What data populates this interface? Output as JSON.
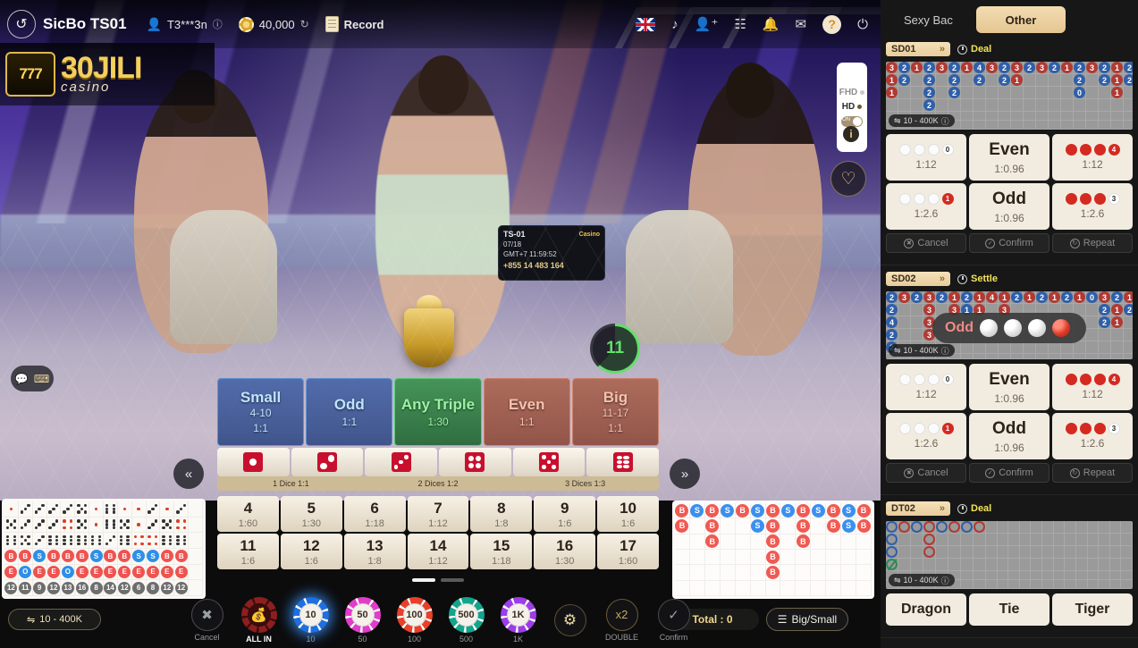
{
  "topbar": {
    "back_icon": "back-arrow-icon",
    "game_name": "SicBo TS01",
    "user_icon": "user-icon",
    "username": "T3***3n",
    "info_icon": "info-icon",
    "balance_icon": "chip-icon",
    "balance": "40,000",
    "refresh_icon": "refresh-icon",
    "record_icon": "record-icon",
    "record_label": "Record",
    "right_icons": [
      "flag-uk-icon",
      "music-icon",
      "add-friend-icon",
      "apps-icon",
      "bell-icon",
      "mail-icon",
      "help-icon",
      "power-icon"
    ]
  },
  "video": {
    "logo_badge": "777",
    "logo_word": "30JILI",
    "logo_sub": "casino",
    "quality": {
      "fhd": "FHD",
      "hd": "HD",
      "toggle": "ON",
      "selected": "HD"
    },
    "info_icon": "info-icon",
    "favorite_icon": "favorite-heart-icon",
    "chat_icon": "chat-icon",
    "keyboard_icon": "keyboard-icon",
    "timer_value": "11",
    "timer_color": "#62e06a",
    "board": {
      "table": "TS-01",
      "date": "07/18",
      "gmt": "GMT+7  11:59:52",
      "phone": "+855 14 483 164",
      "brand": "Casino"
    }
  },
  "main_bets": {
    "items": [
      {
        "title": "Small",
        "range": "4-10",
        "odds": "1:1",
        "style": "blue",
        "selected": false
      },
      {
        "title": "Odd",
        "range": "",
        "odds": "1:1",
        "style": "blue",
        "selected": false
      },
      {
        "title": "Any Triple",
        "range": "",
        "odds": "1:30",
        "style": "green",
        "selected": false
      },
      {
        "title": "Even",
        "range": "",
        "odds": "1:1",
        "style": "red",
        "selected": false
      },
      {
        "title": "Big",
        "range": "11-17",
        "odds": "1:1",
        "style": "red",
        "selected": false
      }
    ],
    "dice_buttons": [
      1,
      2,
      3,
      4,
      5,
      6
    ],
    "dice_labels": [
      "1 Dice 1:1",
      "2 Dices 1:2",
      "3 Dices 1:3"
    ],
    "numbers": [
      {
        "n": "4",
        "o": "1:60"
      },
      {
        "n": "5",
        "o": "1:30"
      },
      {
        "n": "6",
        "o": "1:18"
      },
      {
        "n": "7",
        "o": "1:12"
      },
      {
        "n": "8",
        "o": "1:8"
      },
      {
        "n": "9",
        "o": "1:6"
      },
      {
        "n": "10",
        "o": "1:6"
      },
      {
        "n": "11",
        "o": "1:6"
      },
      {
        "n": "12",
        "o": "1:6"
      },
      {
        "n": "13",
        "o": "1:8"
      },
      {
        "n": "14",
        "o": "1:12"
      },
      {
        "n": "15",
        "o": "1:18"
      },
      {
        "n": "16",
        "o": "1:30"
      },
      {
        "n": "17",
        "o": "1:60"
      }
    ],
    "pager": {
      "pages": 2,
      "active": 0
    },
    "arrow_left_icon": "chevron-left-double-icon",
    "arrow_right_icon": "chevron-right-double-icon"
  },
  "bottom": {
    "limit_badge": "10 - 400K",
    "limit_icon": "bet-limit-icon",
    "total_label": "Total : 0",
    "bigsmall_label": "Big/Small",
    "bigsmall_icon": "chart-icon",
    "chips": [
      {
        "name": "cancel",
        "label": "Cancel",
        "icon": "close-icon",
        "kind": "circle"
      },
      {
        "name": "all-in",
        "label": "ALL IN",
        "icon": "money-bag-icon",
        "kind": "allin",
        "color": "#8c1f1f"
      },
      {
        "name": "chip-10",
        "label": "10",
        "kind": "chip",
        "color": "#1f6fe0",
        "selected": true
      },
      {
        "name": "chip-50",
        "label": "50",
        "kind": "chip",
        "color": "#e23ccb",
        "selected": false
      },
      {
        "name": "chip-100",
        "label": "100",
        "kind": "chip",
        "color": "#e8412a",
        "selected": false
      },
      {
        "name": "chip-500",
        "label": "500",
        "kind": "chip",
        "color": "#13a58c",
        "selected": false
      },
      {
        "name": "chip-1k",
        "label": "1K",
        "kind": "chip",
        "color": "#9d3de8",
        "selected": false
      },
      {
        "name": "settings",
        "label": "",
        "icon": "gear-icon",
        "kind": "gear"
      },
      {
        "name": "double",
        "label": "DOUBLE",
        "icon": "x2-icon",
        "kind": "double"
      },
      {
        "name": "confirm",
        "label": "Confirm",
        "icon": "check-icon",
        "kind": "circle"
      }
    ]
  },
  "left_road": {
    "rows": [
      [
        "d1r",
        "d3",
        "d3",
        "d3",
        "d3",
        "d5",
        "d1r",
        "d6",
        "d1r",
        "d1r",
        "d3",
        "d1r",
        "d3"
      ],
      [
        "d5",
        "d3",
        "d3",
        "d3",
        "d4r",
        "d5",
        "d1r",
        "d6",
        "d5",
        "d1r",
        "d3",
        "d5",
        "d4r"
      ],
      [
        "d6",
        "d5",
        "d3",
        "d6",
        "d6",
        "d6",
        "d6",
        "d3",
        "d6",
        "d4r",
        "d4r",
        "d6",
        "d6"
      ]
    ],
    "bs_row": [
      "B",
      "B",
      "S",
      "B",
      "B",
      "B",
      "S",
      "B",
      "B",
      "S",
      "S",
      "B",
      "B"
    ],
    "oe_row": [
      "E",
      "O",
      "E",
      "E",
      "O",
      "E",
      "E",
      "E",
      "E",
      "E",
      "E",
      "E",
      "E"
    ],
    "total_row": [
      "12",
      "11",
      "9",
      "12",
      "13",
      "16",
      "8",
      "14",
      "12",
      "6",
      "8",
      "12",
      "12"
    ]
  },
  "bead_road": {
    "columns": [
      [
        "B",
        "B"
      ],
      [
        "S"
      ],
      [
        "B",
        "B",
        "B"
      ],
      [
        "S"
      ],
      [
        "B"
      ],
      [
        "S",
        "S"
      ],
      [
        "B",
        "B",
        "B",
        "B",
        "B"
      ],
      [
        "S"
      ],
      [
        "B",
        "B",
        "B"
      ],
      [
        "S"
      ],
      [
        "B",
        "B"
      ],
      [
        "S",
        "S"
      ],
      [
        "B",
        "B"
      ]
    ]
  },
  "sidebar": {
    "tabs": [
      {
        "label": "Sexy Bac",
        "active": false
      },
      {
        "label": "Other",
        "active": true
      }
    ],
    "tables": [
      {
        "id": "SD01",
        "chevron_icon": "chevron-right-double-icon",
        "state": "Deal",
        "limit": "10 - 400K",
        "road_columns": [
          [
            "r3",
            "r1",
            "r1"
          ],
          [
            "b2",
            "b2"
          ],
          [
            "r1"
          ],
          [
            "b2",
            "b2",
            "b2",
            "b2"
          ],
          [
            "r3"
          ],
          [
            "b2",
            "b2",
            "b2"
          ],
          [
            "r1"
          ],
          [
            "b4",
            "b2"
          ],
          [
            "r3"
          ],
          [
            "b2",
            "b2"
          ],
          [
            "r3",
            "r1"
          ],
          [
            "b2"
          ],
          [
            "r3"
          ],
          [
            "b2"
          ],
          [
            "r1"
          ],
          [
            "b2",
            "b2",
            "b0"
          ],
          [
            "r3"
          ],
          [
            "b2",
            "b2"
          ],
          [
            "r1",
            "r1",
            "r1"
          ],
          [
            "b2",
            "b2"
          ]
        ],
        "bets": [
          {
            "kind": "dots",
            "dots": "www",
            "count": "0",
            "count_style": "white",
            "odds": "1:12"
          },
          {
            "kind": "text",
            "cap": "Even",
            "odds": "1:0.96"
          },
          {
            "kind": "dots",
            "dots": "rrr",
            "count": "4",
            "count_style": "red",
            "odds": "1:12"
          },
          {
            "kind": "dots",
            "dots": "www",
            "count": "1",
            "count_style": "red",
            "odds": "1:2.6"
          },
          {
            "kind": "text",
            "cap": "Odd",
            "odds": "1:0.96"
          },
          {
            "kind": "dots",
            "dots": "rrr",
            "count": "3",
            "count_style": "white",
            "odds": "1:2.6"
          }
        ],
        "actions": [
          {
            "label": "Cancel",
            "icon": "close-icon"
          },
          {
            "label": "Confirm",
            "icon": "check-icon"
          },
          {
            "label": "Repeat",
            "icon": "repeat-icon"
          }
        ]
      },
      {
        "id": "SD02",
        "chevron_icon": "chevron-right-double-icon",
        "state": "Settle",
        "limit": "10 - 400K",
        "result": {
          "label": "Odd",
          "balls": [
            "white",
            "white",
            "white",
            "red"
          ]
        },
        "road_columns": [
          [
            "b2",
            "b2",
            "b4",
            "b2",
            "b2"
          ],
          [
            "r3"
          ],
          [
            "b2"
          ],
          [
            "r3",
            "r3",
            "r3",
            "r3"
          ],
          [
            "b2"
          ],
          [
            "r1",
            "r3"
          ],
          [
            "b2",
            "b1"
          ],
          [
            "r1",
            "r1"
          ],
          [
            "r4"
          ],
          [
            "r1",
            "r3"
          ],
          [
            "b2"
          ],
          [
            "r1"
          ],
          [
            "b2"
          ],
          [
            "r1"
          ],
          [
            "b2"
          ],
          [
            "r1"
          ],
          [
            "b0"
          ],
          [
            "r3",
            "b2",
            "b2"
          ],
          [
            "b2",
            "r1",
            "r1"
          ],
          [
            "r1",
            "b2"
          ]
        ],
        "bets": [
          {
            "kind": "dots",
            "dots": "www",
            "count": "0",
            "count_style": "white",
            "odds": "1:12"
          },
          {
            "kind": "text",
            "cap": "Even",
            "odds": "1:0.96"
          },
          {
            "kind": "dots",
            "dots": "rrr",
            "count": "4",
            "count_style": "red",
            "odds": "1:12"
          },
          {
            "kind": "dots",
            "dots": "www",
            "count": "1",
            "count_style": "red",
            "odds": "1:2.6"
          },
          {
            "kind": "text",
            "cap": "Odd",
            "odds": "1:0.96"
          },
          {
            "kind": "dots",
            "dots": "rrr",
            "count": "3",
            "count_style": "white",
            "odds": "1:2.6"
          }
        ],
        "actions": [
          {
            "label": "Cancel",
            "icon": "close-icon"
          },
          {
            "label": "Confirm",
            "icon": "check-icon"
          },
          {
            "label": "Repeat",
            "icon": "repeat-icon"
          }
        ]
      },
      {
        "id": "DT02",
        "chevron_icon": "chevron-right-double-icon",
        "state": "Deal",
        "limit": "10 - 400K",
        "road_columns": [
          [
            "hb",
            "hb",
            "hb",
            "tie"
          ],
          [
            "hr"
          ],
          [
            "hb"
          ],
          [
            "hr",
            "hr",
            "hr"
          ],
          [
            "hb"
          ],
          [
            "hr"
          ],
          [
            "hb"
          ],
          [
            "hr"
          ]
        ],
        "dt_bets": [
          {
            "label": "Dragon"
          },
          {
            "label": "Tie"
          },
          {
            "label": "Tiger"
          }
        ]
      }
    ]
  }
}
